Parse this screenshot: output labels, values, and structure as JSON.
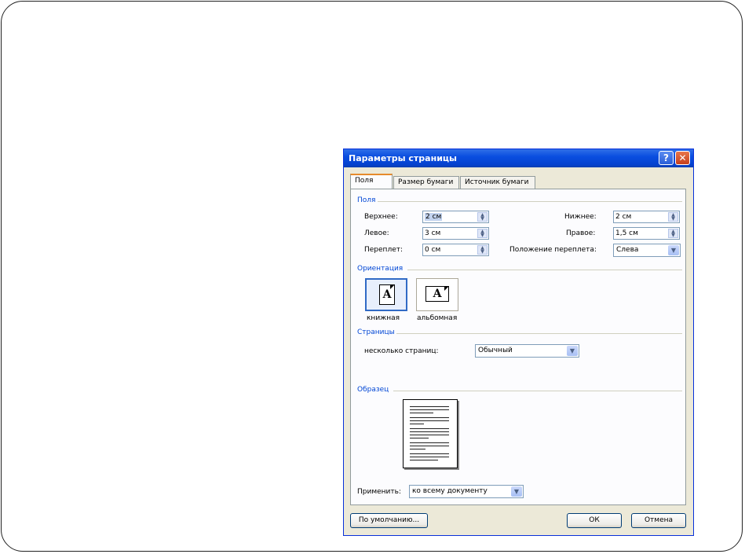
{
  "dialog": {
    "title": "Параметры страницы",
    "help_glyph": "?",
    "close_glyph": "✕",
    "tabs": [
      {
        "label": "Поля"
      },
      {
        "label": "Размер бумаги"
      },
      {
        "label": "Источник бумаги"
      }
    ],
    "margins": {
      "group_title": "Поля",
      "top_label": "Верхнее:",
      "top_value": "2 см",
      "bottom_label": "Нижнее:",
      "bottom_value": "2 см",
      "left_label": "Левое:",
      "left_value": "3 см",
      "right_label": "Правое:",
      "right_value": "1,5 см",
      "gutter_label": "Переплет:",
      "gutter_value": "0 см",
      "gutter_pos_label": "Положение переплета:",
      "gutter_pos_value": "Слева"
    },
    "orientation": {
      "group_title": "Ориентация",
      "portrait_label": "книжная",
      "landscape_label": "альбомная",
      "icon_letter": "A",
      "selected": "portrait"
    },
    "pages": {
      "group_title": "Страницы",
      "multiple_label": "несколько страниц:",
      "multiple_value": "Обычный"
    },
    "preview": {
      "group_title": "Образец",
      "apply_label": "Применить:",
      "apply_value": "ко всему документу"
    },
    "buttons": {
      "default": "По умолчанию...",
      "ok": "ОК",
      "cancel": "Отмена"
    }
  },
  "colors": {
    "titlebar": "#0a4ee0",
    "group_title": "#0046d5",
    "dialog_bg": "#ece9d8"
  }
}
